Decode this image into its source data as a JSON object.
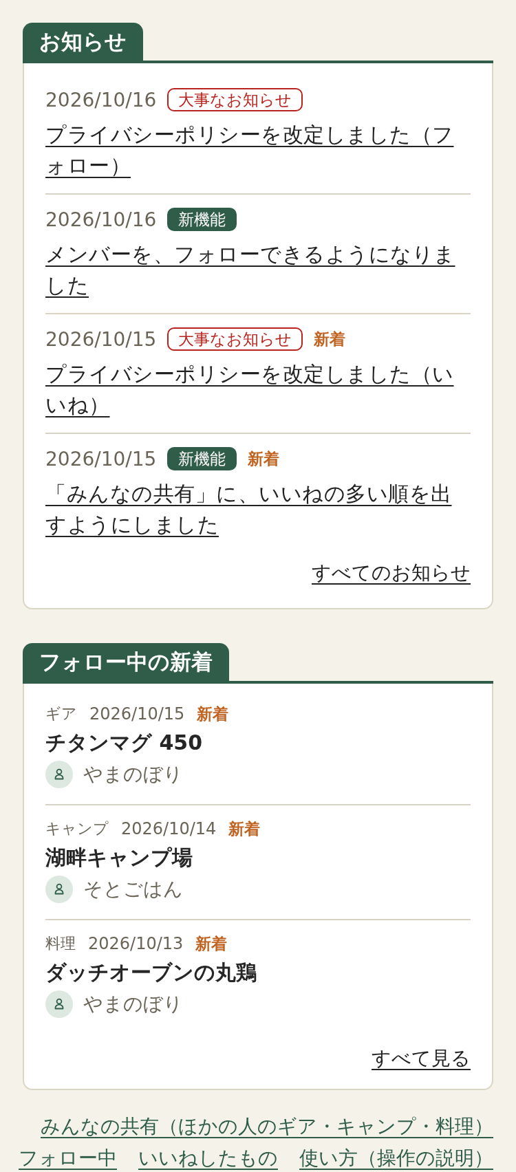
{
  "notices": {
    "title": "お知らせ",
    "items": [
      {
        "date": "2026/10/16",
        "tags": [
          {
            "kind": "important",
            "label": "大事なお知らせ"
          }
        ],
        "title": "プライバシーポリシーを改定しました（フォロー）"
      },
      {
        "date": "2026/10/16",
        "tags": [
          {
            "kind": "feature",
            "label": "新機能"
          }
        ],
        "title": "メンバーを、フォローできるようになりました"
      },
      {
        "date": "2026/10/15",
        "tags": [
          {
            "kind": "important",
            "label": "大事なお知らせ"
          },
          {
            "kind": "new",
            "label": "新着"
          }
        ],
        "title": "プライバシーポリシーを改定しました（いいね）"
      },
      {
        "date": "2026/10/15",
        "tags": [
          {
            "kind": "feature",
            "label": "新機能"
          },
          {
            "kind": "new",
            "label": "新着"
          }
        ],
        "title": "「みんなの共有」に、いいねの多い順を出すようにしました"
      }
    ],
    "all_link": "すべてのお知らせ"
  },
  "following": {
    "title": "フォロー中の新着",
    "items": [
      {
        "category": "ギア",
        "date": "2026/10/15",
        "tags": [
          {
            "kind": "new",
            "label": "新着"
          }
        ],
        "title": "チタンマグ 450",
        "author": "やまのぼり"
      },
      {
        "category": "キャンプ",
        "date": "2026/10/14",
        "tags": [
          {
            "kind": "new",
            "label": "新着"
          }
        ],
        "title": "湖畔キャンプ場",
        "author": "そとごはん"
      },
      {
        "category": "料理",
        "date": "2026/10/13",
        "tags": [
          {
            "kind": "new",
            "label": "新着"
          }
        ],
        "title": "ダッチオーブンの丸鶏",
        "author": "やまのぼり"
      }
    ],
    "all_link": "すべて見る"
  },
  "footer_links": [
    [
      "みんなの共有（ほかの人のギア・キャンプ・料理）"
    ],
    [
      "フォロー中",
      "いいねしたもの",
      "使い方（操作の説明）"
    ]
  ]
}
